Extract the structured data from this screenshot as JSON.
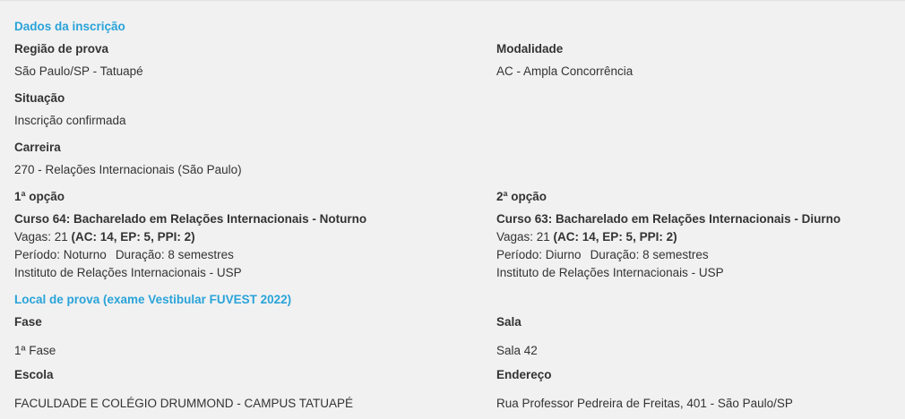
{
  "inscricao": {
    "section_title": "Dados da inscrição",
    "regiao_label": "Região de prova",
    "regiao_value": "São Paulo/SP - Tatuapé",
    "modalidade_label": "Modalidade",
    "modalidade_value": "AC - Ampla Concorrência",
    "situacao_label": "Situação",
    "situacao_value": "Inscrição confirmada",
    "carreira_label": "Carreira",
    "carreira_value": "270 - Relações Internacionais (São Paulo)"
  },
  "opcoes": [
    {
      "label": "1ª opção",
      "curso": "Curso 64: Bacharelado em Relações Internacionais - Noturno",
      "vagas_prefix": "Vagas: 21 ",
      "vagas_detail": "(AC: 14, EP: 5, PPI: 2)",
      "periodo": "Período: Noturno",
      "duracao": "Duração: 8 semestres",
      "instituto": "Instituto de Relações Internacionais - USP"
    },
    {
      "label": "2ª opção",
      "curso": "Curso 63: Bacharelado em Relações Internacionais - Diurno",
      "vagas_prefix": "Vagas: 21 ",
      "vagas_detail": "(AC: 14, EP: 5, PPI: 2)",
      "periodo": "Período: Diurno",
      "duracao": "Duração: 8 semestres",
      "instituto": "Instituto de Relações Internacionais - USP"
    }
  ],
  "local": {
    "section_title": "Local de prova (exame Vestibular FUVEST 2022)",
    "fase_label": "Fase",
    "fase_value": "1ª Fase",
    "sala_label": "Sala",
    "sala_value": "Sala 42",
    "escola_label": "Escola",
    "escola_value": "FACULDADE E COLÉGIO DRUMMOND - CAMPUS TATUAPÉ",
    "endereco_label": "Endereço",
    "endereco_value": "Rua Professor Pedreira de Freitas, 401 - São Paulo/SP"
  }
}
